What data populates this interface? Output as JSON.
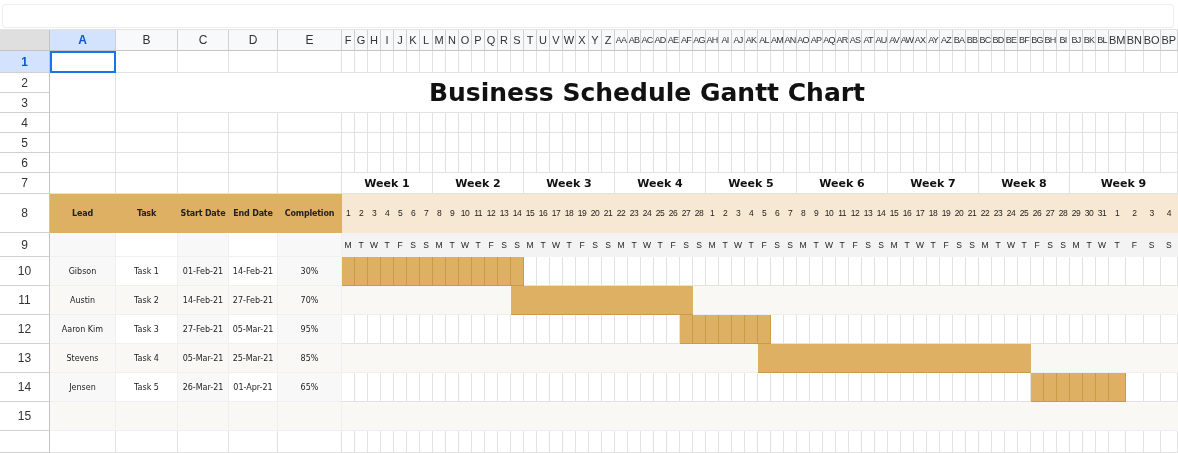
{
  "columns": [
    {
      "label": "A",
      "selected": true
    },
    {
      "label": "B",
      "selected": false
    },
    {
      "label": "C",
      "selected": false
    },
    {
      "label": "D",
      "selected": false
    },
    {
      "label": "E",
      "selected": false
    },
    {
      "label": "F",
      "selected": false
    },
    {
      "label": "G",
      "selected": false
    },
    {
      "label": "H",
      "selected": false
    },
    {
      "label": "I",
      "selected": false
    },
    {
      "label": "J",
      "selected": false
    },
    {
      "label": "K",
      "selected": false
    },
    {
      "label": "L",
      "selected": false
    },
    {
      "label": "M",
      "selected": false
    },
    {
      "label": "N",
      "selected": false
    },
    {
      "label": "O",
      "selected": false
    },
    {
      "label": "P",
      "selected": false
    },
    {
      "label": "Q",
      "selected": false
    },
    {
      "label": "R",
      "selected": false
    },
    {
      "label": "S",
      "selected": false
    },
    {
      "label": "T",
      "selected": false
    },
    {
      "label": "U",
      "selected": false
    },
    {
      "label": "V",
      "selected": false
    },
    {
      "label": "W",
      "selected": false
    },
    {
      "label": "X",
      "selected": false
    },
    {
      "label": "Y",
      "selected": false
    },
    {
      "label": "Z",
      "selected": false
    },
    {
      "label": "AA",
      "selected": false
    },
    {
      "label": "AB",
      "selected": false
    },
    {
      "label": "AC",
      "selected": false
    },
    {
      "label": "AD",
      "selected": false
    },
    {
      "label": "AE",
      "selected": false
    },
    {
      "label": "AF",
      "selected": false
    },
    {
      "label": "AG",
      "selected": false
    },
    {
      "label": "AH",
      "selected": false
    },
    {
      "label": "AI",
      "selected": false
    },
    {
      "label": "AJ",
      "selected": false
    },
    {
      "label": "AK",
      "selected": false
    },
    {
      "label": "AL",
      "selected": false
    },
    {
      "label": "AM",
      "selected": false
    },
    {
      "label": "AN",
      "selected": false
    },
    {
      "label": "AO",
      "selected": false
    },
    {
      "label": "AP",
      "selected": false
    },
    {
      "label": "AQ",
      "selected": false
    },
    {
      "label": "AR",
      "selected": false
    },
    {
      "label": "AS",
      "selected": false
    },
    {
      "label": "AT",
      "selected": false
    },
    {
      "label": "AU",
      "selected": false
    },
    {
      "label": "AV",
      "selected": false
    },
    {
      "label": "AW",
      "selected": false
    },
    {
      "label": "AX",
      "selected": false
    },
    {
      "label": "AY",
      "selected": false
    },
    {
      "label": "AZ",
      "selected": false
    },
    {
      "label": "BA",
      "selected": false
    },
    {
      "label": "BB",
      "selected": false
    },
    {
      "label": "BC",
      "selected": false
    },
    {
      "label": "BD",
      "selected": false
    },
    {
      "label": "BE",
      "selected": false
    },
    {
      "label": "BF",
      "selected": false
    },
    {
      "label": "BG",
      "selected": false
    },
    {
      "label": "BH",
      "selected": false
    },
    {
      "label": "BI",
      "selected": false
    },
    {
      "label": "BJ",
      "selected": false
    },
    {
      "label": "BK",
      "selected": false
    },
    {
      "label": "BL",
      "selected": false
    },
    {
      "label": "BM",
      "selected": false
    },
    {
      "label": "BN",
      "selected": false
    },
    {
      "label": "BO",
      "selected": false
    },
    {
      "label": "BP",
      "selected": false
    }
  ],
  "rows": [
    {
      "label": "1",
      "selected": true
    },
    {
      "label": "2",
      "selected": false
    },
    {
      "label": "3",
      "selected": false
    },
    {
      "label": "4",
      "selected": false
    },
    {
      "label": "5",
      "selected": false
    },
    {
      "label": "6",
      "selected": false
    },
    {
      "label": "7",
      "selected": false
    },
    {
      "label": "8",
      "selected": false
    },
    {
      "label": "9",
      "selected": false
    },
    {
      "label": "10",
      "selected": false
    },
    {
      "label": "11",
      "selected": false
    },
    {
      "label": "12",
      "selected": false
    },
    {
      "label": "13",
      "selected": false
    },
    {
      "label": "14",
      "selected": false
    },
    {
      "label": "15",
      "selected": false
    }
  ],
  "title": "Business Schedule Gantt Chart",
  "weeks": [
    "Week 1",
    "Week 2",
    "Week 3",
    "Week 4",
    "Week 5",
    "Week 6",
    "Week 7",
    "Week 8",
    "Week 9"
  ],
  "day_numbers": [
    "1",
    "2",
    "3",
    "4",
    "5",
    "6",
    "7",
    "8",
    "9",
    "10",
    "11",
    "12",
    "13",
    "14",
    "15",
    "16",
    "17",
    "18",
    "19",
    "20",
    "21",
    "22",
    "23",
    "24",
    "25",
    "26",
    "27",
    "28",
    "1",
    "2",
    "3",
    "4",
    "5",
    "6",
    "7",
    "8",
    "9",
    "10",
    "11",
    "12",
    "13",
    "14",
    "15",
    "16",
    "17",
    "18",
    "19",
    "20",
    "21",
    "22",
    "23",
    "24",
    "25",
    "26",
    "27",
    "28",
    "29",
    "30",
    "31",
    "1",
    "2",
    "3",
    "4"
  ],
  "weekdays": [
    "M",
    "T",
    "W",
    "T",
    "F",
    "S",
    "S",
    "M",
    "T",
    "W",
    "T",
    "F",
    "S",
    "S",
    "M",
    "T",
    "W",
    "T",
    "F",
    "S",
    "S",
    "M",
    "T",
    "W",
    "T",
    "F",
    "S",
    "S",
    "M",
    "T",
    "W",
    "T",
    "F",
    "S",
    "S",
    "M",
    "T",
    "W",
    "T",
    "F",
    "S",
    "S",
    "M",
    "T",
    "W",
    "T",
    "F",
    "S",
    "S",
    "M",
    "T",
    "W",
    "T",
    "F",
    "S",
    "S",
    "M",
    "T",
    "W",
    "T",
    "F",
    "S",
    "S"
  ],
  "table": {
    "columns": [
      "Lead",
      "Task",
      "Start Date",
      "End Date",
      "Completion"
    ],
    "rows": [
      {
        "lead": "Gibson",
        "task": "Task 1",
        "start": "01-Feb-21",
        "end": "14-Feb-21",
        "completion": "30%",
        "timeline": [
          true,
          true,
          true,
          true,
          true,
          true,
          true,
          true,
          true,
          true,
          true,
          true,
          true,
          true,
          false,
          false,
          false,
          false,
          false,
          false,
          false,
          false,
          false,
          false,
          false,
          false,
          false,
          false,
          false,
          false,
          false,
          false,
          false,
          false,
          false,
          false,
          false,
          false,
          false,
          false,
          false,
          false,
          false,
          false,
          false,
          false,
          false,
          false,
          false,
          false,
          false,
          false,
          false,
          false,
          false,
          false,
          false,
          false,
          false,
          false,
          false,
          false,
          false
        ]
      },
      {
        "lead": "Austin",
        "task": "Task 2",
        "start": "14-Feb-21",
        "end": "27-Feb-21",
        "completion": "70%",
        "timeline": [
          false,
          false,
          false,
          false,
          false,
          false,
          false,
          false,
          false,
          false,
          false,
          false,
          false,
          true,
          true,
          true,
          true,
          true,
          true,
          true,
          true,
          true,
          true,
          true,
          true,
          true,
          true,
          false,
          false,
          false,
          false,
          false,
          false,
          false,
          false,
          false,
          false,
          false,
          false,
          false,
          false,
          false,
          false,
          false,
          false,
          false,
          false,
          false,
          false,
          false,
          false,
          false,
          false,
          false,
          false,
          false,
          false,
          false,
          false,
          false,
          false,
          false,
          false
        ]
      },
      {
        "lead": "Aaron Kim",
        "task": "Task 3",
        "start": "27-Feb-21",
        "end": "05-Mar-21",
        "completion": "95%",
        "timeline": [
          false,
          false,
          false,
          false,
          false,
          false,
          false,
          false,
          false,
          false,
          false,
          false,
          false,
          false,
          false,
          false,
          false,
          false,
          false,
          false,
          false,
          false,
          false,
          false,
          false,
          false,
          true,
          true,
          true,
          true,
          true,
          true,
          true,
          false,
          false,
          false,
          false,
          false,
          false,
          false,
          false,
          false,
          false,
          false,
          false,
          false,
          false,
          false,
          false,
          false,
          false,
          false,
          false,
          false,
          false,
          false,
          false,
          false,
          false,
          false,
          false,
          false,
          false
        ]
      },
      {
        "lead": "Stevens",
        "task": "Task 4",
        "start": "05-Mar-21",
        "end": "25-Mar-21",
        "completion": "85%",
        "timeline": [
          false,
          false,
          false,
          false,
          false,
          false,
          false,
          false,
          false,
          false,
          false,
          false,
          false,
          false,
          false,
          false,
          false,
          false,
          false,
          false,
          false,
          false,
          false,
          false,
          false,
          false,
          false,
          false,
          false,
          false,
          false,
          false,
          true,
          true,
          true,
          true,
          true,
          true,
          true,
          true,
          true,
          true,
          true,
          true,
          true,
          true,
          true,
          true,
          true,
          true,
          true,
          true,
          true,
          false,
          false,
          false,
          false,
          false,
          false,
          false,
          false,
          false,
          false
        ]
      },
      {
        "lead": "Jensen",
        "task": "Task 5",
        "start": "26-Mar-21",
        "end": "01-Apr-21",
        "completion": "65%",
        "timeline": [
          false,
          false,
          false,
          false,
          false,
          false,
          false,
          false,
          false,
          false,
          false,
          false,
          false,
          false,
          false,
          false,
          false,
          false,
          false,
          false,
          false,
          false,
          false,
          false,
          false,
          false,
          false,
          false,
          false,
          false,
          false,
          false,
          false,
          false,
          false,
          false,
          false,
          false,
          false,
          false,
          false,
          false,
          false,
          false,
          false,
          false,
          false,
          false,
          false,
          false,
          false,
          false,
          false,
          true,
          true,
          true,
          true,
          true,
          true,
          true,
          false,
          false,
          false
        ]
      }
    ]
  }
}
